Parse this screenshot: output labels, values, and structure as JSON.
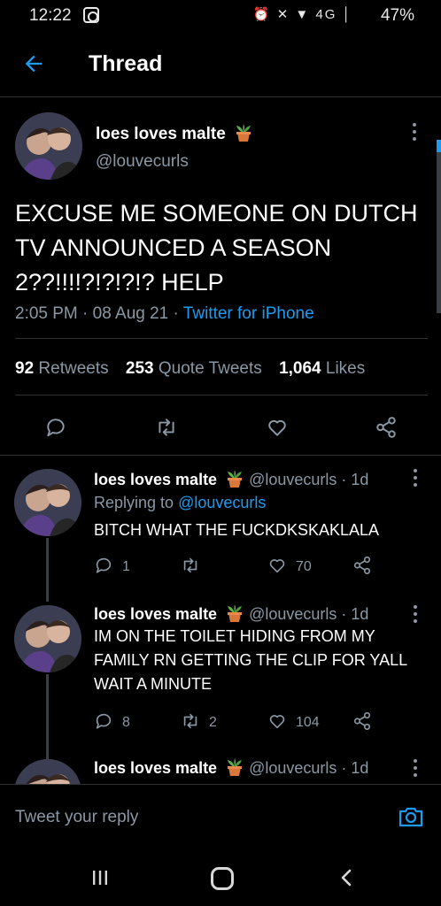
{
  "status_bar": {
    "time": "12:22",
    "system_icons": "⏰ ✕ ▼ 4G │",
    "battery": "47%"
  },
  "header": {
    "title": "Thread"
  },
  "main_tweet": {
    "name": "loes loves malte",
    "handle": "@louvecurls",
    "text": "EXCUSE ME SOMEONE ON DUTCH TV ANNOUNCED A SEASON 2??!!!!?!?!?!? HELP",
    "time": "2:05 PM",
    "date": "08 Aug 21",
    "source": "Twitter for iPhone",
    "retweets": "92",
    "retweets_label": "Retweets",
    "quotes": "253",
    "quotes_label": "Quote Tweets",
    "likes": "1,064",
    "likes_label": "Likes"
  },
  "replies": [
    {
      "name": "loes loves malte",
      "handle": "@louvecurls",
      "age": "1d",
      "replying_prefix": "Replying to",
      "replying_to": "@louvecurls",
      "text": "BITCH WHAT THE FUCKDKSKAKLALA",
      "replies_count": "1",
      "retweets_count": "",
      "likes_count": "70"
    },
    {
      "name": "loes loves malte",
      "handle": "@louvecurls",
      "age": "1d",
      "text": "IM ON THE TOILET HIDING FROM MY FAMILY RN GETTING THE CLIP FOR YALL WAIT A MINUTE",
      "replies_count": "8",
      "retweets_count": "2",
      "likes_count": "104"
    },
    {
      "name": "loes loves malte",
      "handle": "@louvecurls",
      "age": "1d"
    }
  ],
  "reply_bar": {
    "placeholder": "Tweet your reply"
  },
  "colors": {
    "accent": "#1d9bf0",
    "muted": "#8b98a5",
    "background": "#000000",
    "divider": "#2f3336"
  }
}
